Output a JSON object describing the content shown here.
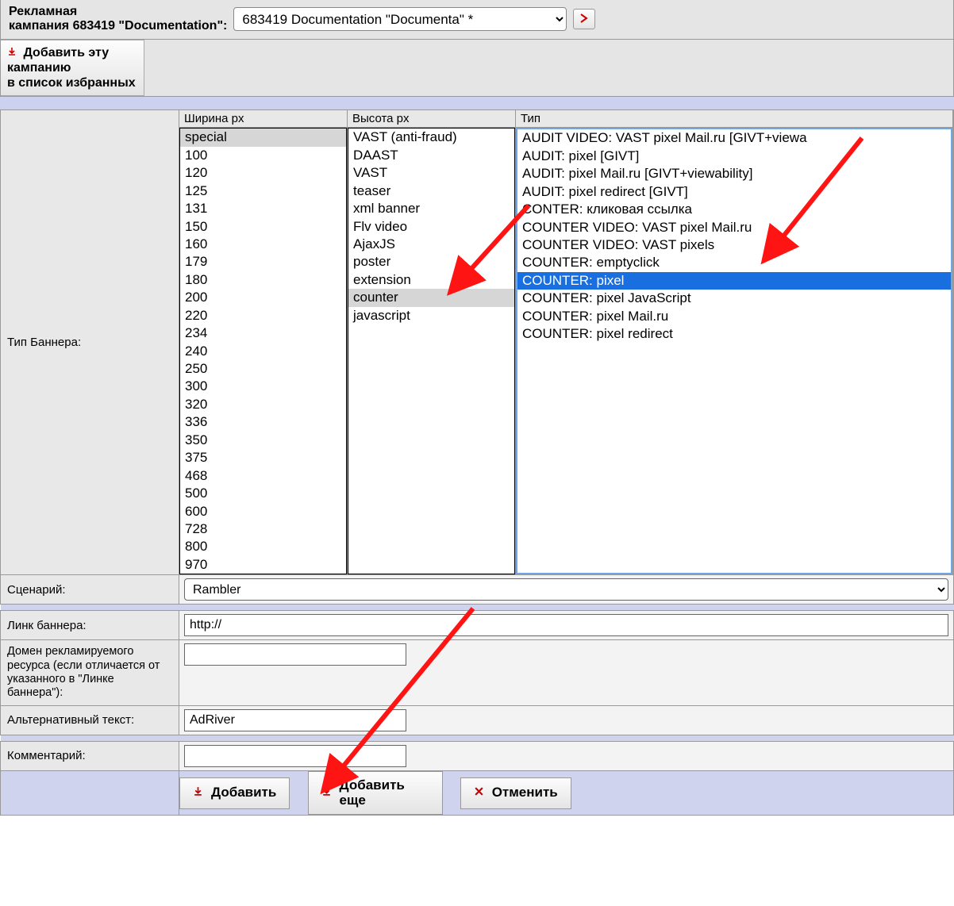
{
  "header": {
    "label": "Рекламная\nкампания 683419 \"Documentation\":",
    "selected_campaign": "683419 Documentation \"Documenta\" *",
    "favorite_button": "Добавить эту\nкампанию\nв список избранных"
  },
  "rows": {
    "banner_type_label": "Тип Баннера:",
    "width_header": "Ширина px",
    "height_header": "Высота px",
    "type_header": "Тип",
    "widths": [
      "special",
      "100",
      "120",
      "125",
      "131",
      "150",
      "160",
      "179",
      "180",
      "200",
      "220",
      "234",
      "240",
      "250",
      "300",
      "320",
      "336",
      "350",
      "375",
      "468",
      "500",
      "600",
      "728",
      "800",
      "970"
    ],
    "width_selected": "special",
    "heights": [
      "VAST (anti-fraud)",
      "DAAST",
      "VAST",
      "teaser",
      "xml banner",
      "Flv video",
      "AjaxJS",
      "poster",
      "extension",
      "counter",
      "javascript"
    ],
    "height_selected": "counter",
    "types": [
      "AUDIT VIDEO: VAST pixel Mail.ru [GIVT+viewa",
      "AUDIT: pixel [GIVT]",
      "AUDIT: pixel Mail.ru [GIVT+viewability]",
      "AUDIT: pixel redirect [GIVT]",
      "CONTER: кликовая ссылка",
      "COUNTER VIDEO: VAST pixel Mail.ru",
      "COUNTER VIDEO: VAST pixels",
      "COUNTER: emptyclick",
      "COUNTER: pixel",
      "COUNTER: pixel JavaScript",
      "COUNTER: pixel Mail.ru",
      "COUNTER: pixel redirect"
    ],
    "type_selected": "COUNTER: pixel",
    "scenario_label": "Сценарий:",
    "scenario_value": "Rambler",
    "link_label": "Линк баннера:",
    "link_value": "http://",
    "domain_label": "Домен рекламируемого ресурса (если отличается от указанного в \"Линке баннера\"):",
    "domain_value": "",
    "alt_label": "Альтернативный текст:",
    "alt_value": "AdRiver",
    "comment_label": "Комментарий:",
    "comment_value": ""
  },
  "buttons": {
    "add": "Добавить",
    "add_more": "Добавить еще",
    "cancel": "Отменить"
  }
}
